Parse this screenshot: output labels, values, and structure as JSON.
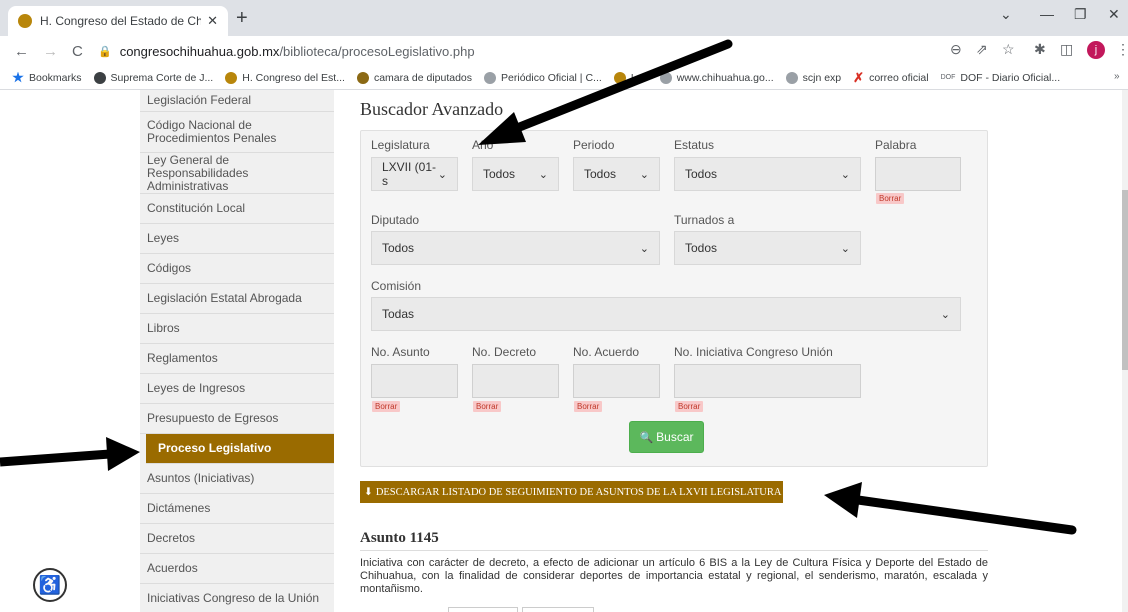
{
  "browser": {
    "tab_title": "H. Congreso del Estado de Chihu",
    "url_domain": "congresochihuahua.gob.mx",
    "url_path": "/biblioteca/procesoLegislativo.php",
    "avatar_letter": "j",
    "bookmarks": [
      {
        "label": "Bookmarks",
        "icon": "star-icon",
        "color": "#1a73e8"
      },
      {
        "label": "Suprema Corte de J...",
        "icon": "globe-icon",
        "color": "#3c4043"
      },
      {
        "label": "H. Congreso del Est...",
        "icon": "congreso-icon",
        "color": "#b8860b"
      },
      {
        "label": "camara de diputados",
        "icon": "camara-icon",
        "color": "#8b6914"
      },
      {
        "label": "Periódico Oficial | C...",
        "icon": "shield-icon",
        "color": "#5f6368"
      },
      {
        "label": "I",
        "icon": "congreso-icon",
        "color": "#b8860b"
      },
      {
        "label": "www.chihuahua.go...",
        "icon": "shield-icon",
        "color": "#5f6368"
      },
      {
        "label": "scjn exp",
        "icon": "scjn-icon",
        "color": "#5f6368"
      },
      {
        "label": "correo oficial",
        "icon": "x-icon",
        "color": "#d93025"
      },
      {
        "label": "DOF - Diario Oficial...",
        "icon": "dof-icon",
        "color": "#5f6368"
      }
    ]
  },
  "sidebar": {
    "items": [
      {
        "label": "Legislación Federal"
      },
      {
        "label": "Código Nacional de Procedimientos Penales"
      },
      {
        "label": "Ley General de Responsabilidades Administrativas"
      },
      {
        "label": "Constitución Local"
      },
      {
        "label": "Leyes"
      },
      {
        "label": "Códigos"
      },
      {
        "label": "Legislación Estatal Abrogada"
      },
      {
        "label": "Libros"
      },
      {
        "label": "Reglamentos"
      },
      {
        "label": "Leyes de Ingresos"
      },
      {
        "label": "Presupuesto de Egresos"
      },
      {
        "label": "Proceso Legislativo"
      },
      {
        "label": "Asuntos (Iniciativas)"
      },
      {
        "label": "Dictámenes"
      },
      {
        "label": "Decretos"
      },
      {
        "label": "Acuerdos"
      },
      {
        "label": "Iniciativas Congreso de la Unión"
      }
    ]
  },
  "search": {
    "title": "Buscador Avanzado",
    "legislatura_label": "Legislatura",
    "legislatura_value": "LXVII (01-s",
    "anio_label": "Año",
    "anio_value": "Todos",
    "periodo_label": "Periodo",
    "periodo_value": "Todos",
    "estatus_label": "Estatus",
    "estatus_value": "Todos",
    "palabra_label": "Palabra",
    "diputado_label": "Diputado",
    "diputado_value": "Todos",
    "turnados_label": "Turnados a",
    "turnados_value": "Todos",
    "comision_label": "Comisión",
    "comision_value": "Todas",
    "no_asunto_label": "No. Asunto",
    "no_decreto_label": "No. Decreto",
    "no_acuerdo_label": "No. Acuerdo",
    "no_iniciativa_label": "No. Iniciativa Congreso Unión",
    "borrar_label": "Borrar",
    "buscar_label": "Buscar"
  },
  "download_label": "DESCARGAR LISTADO DE SEGUIMIENTO DE ASUNTOS DE LA LXVII LEGISLATURA",
  "result": {
    "title": "Asunto 1145",
    "description": "Iniciativa con carácter de decreto, a efecto de adicionar un artículo 6 BIS a la Ley de Cultura Física y Deporte del Estado de Chihuahua, con la finalidad de considerar deportes de importancia estatal y regional, el senderismo, maratón, escalada y montañismo."
  }
}
